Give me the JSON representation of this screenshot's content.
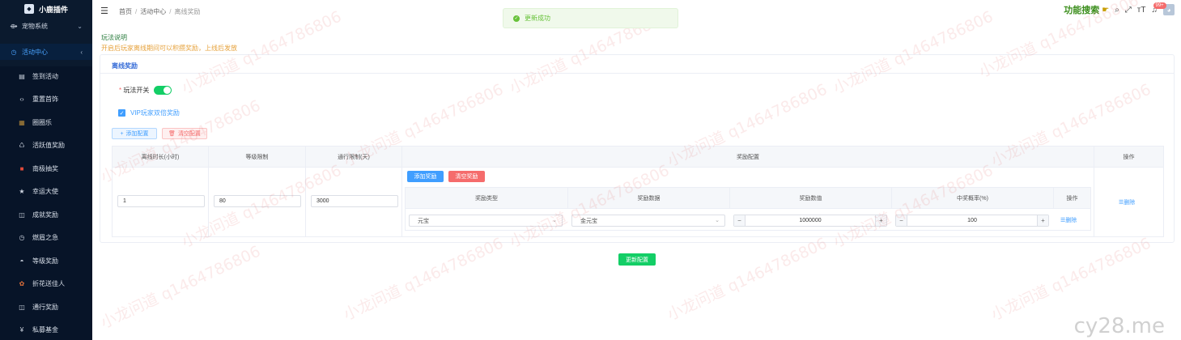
{
  "sidebar": {
    "logo": "小鹿插件",
    "groups": [
      {
        "label": "宠物系统",
        "icon": "plugin-icon",
        "arrow": "⌄"
      },
      {
        "label": "活动中心",
        "icon": "clock-icon",
        "arrow": "‹"
      }
    ],
    "items": [
      {
        "label": "签到活动"
      },
      {
        "label": "重置首饰"
      },
      {
        "label": "圈圈乐"
      },
      {
        "label": "活跃值奖励"
      },
      {
        "label": "南极抽奖"
      },
      {
        "label": "幸运大使"
      },
      {
        "label": "成就奖励"
      },
      {
        "label": "燃眉之急"
      },
      {
        "label": "等级奖励"
      },
      {
        "label": "折花送佳人"
      },
      {
        "label": "通行奖励"
      },
      {
        "label": "私募基金"
      }
    ]
  },
  "header": {
    "breadcrumb": [
      "首页",
      "活动中心",
      "离线奖励"
    ],
    "toast": "更新成功",
    "func_search": "功能搜索",
    "badge": "99+"
  },
  "main": {
    "rules_title": "玩法说明",
    "rules_desc": "开启后玩家离线期间可以积攒奖励，上线后发放",
    "card_title": "离线奖励",
    "switch_label": "玩法开关",
    "switch_on": true,
    "vip_label": "VIP玩家双倍奖励",
    "vip_checked": true,
    "add_config": "添加配置",
    "clear_config": "清空配置",
    "columns": [
      "离线时长(小时)",
      "等级限制",
      "通行限制(天)",
      "奖励配置",
      "操作"
    ],
    "row": {
      "hours": "1",
      "level": "80",
      "pass": "3000"
    },
    "add_reward": "添加奖励",
    "clear_reward": "清空奖励",
    "reward_columns": [
      "奖励类型",
      "奖励数据",
      "奖励数值",
      "中奖概率(%)",
      "操作"
    ],
    "reward_row": {
      "type": "元宝",
      "data": "金元宝",
      "value": "1000000",
      "prob": "100",
      "op": "☰删除"
    },
    "row_op": "☰删除",
    "update_btn": "更新配置"
  },
  "watermark": {
    "text": "小龙问道 q1464786806",
    "site": "cy28.me"
  },
  "colors": {
    "sidebar_bg": "#0b1a2e",
    "accent": "#409eff",
    "success": "#13ce66",
    "danger": "#f56c6c",
    "warning": "#e6a23c"
  }
}
